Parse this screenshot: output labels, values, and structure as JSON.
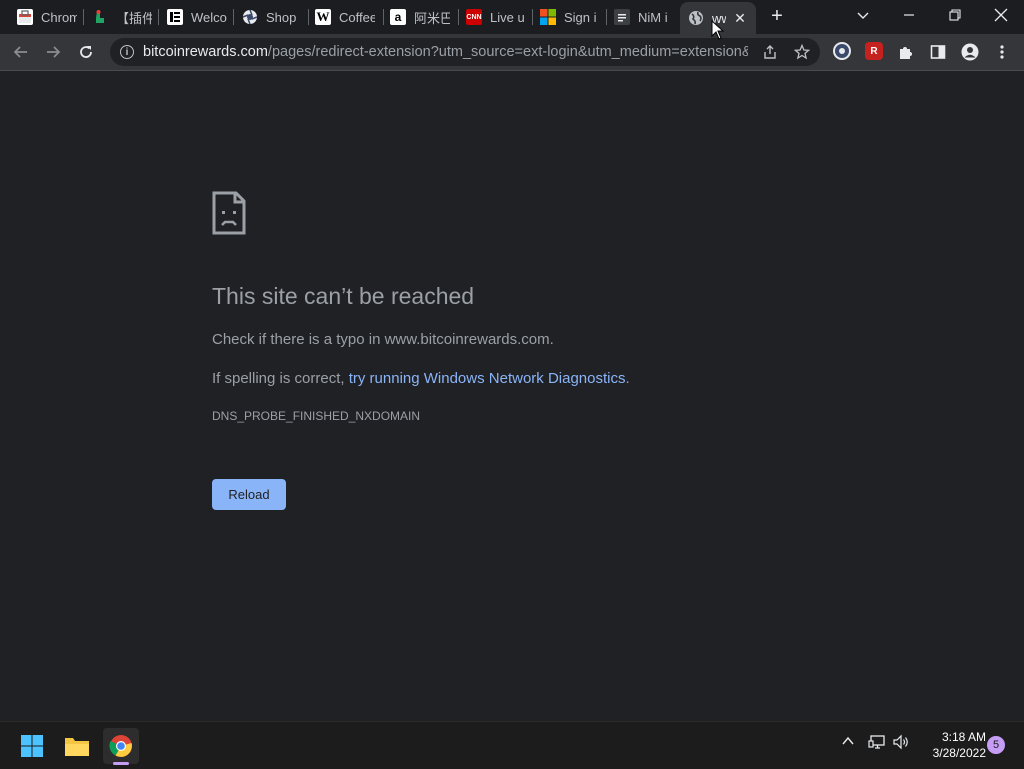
{
  "tabs": [
    {
      "label": "Chrom",
      "icon": "chrome-webstore-icon"
    },
    {
      "label": "【插件",
      "icon": "hand-icon"
    },
    {
      "label": "Welco",
      "icon": "e-icon"
    },
    {
      "label": "Shop",
      "icon": "aperture-icon"
    },
    {
      "label": "Coffee",
      "icon": "w-icon"
    },
    {
      "label": "阿米巴",
      "icon": "amazon-icon"
    },
    {
      "label": "Live u",
      "icon": "cnn-icon"
    },
    {
      "label": "Sign i",
      "icon": "microsoft-icon"
    },
    {
      "label": "NiM i",
      "icon": "doc-icon"
    }
  ],
  "active_tab": {
    "label": "ww",
    "icon": "globe-icon",
    "close": "✕"
  },
  "new_tab": "+",
  "window_controls": {
    "dropdown": "⌄",
    "minimize": "—",
    "restore": "❐",
    "close": "✕"
  },
  "address_bar": {
    "host": "bitcoinrewards.com",
    "path": "/pages/redirect-extension?utm_source=ext-login&utm_medium=extension&..."
  },
  "extensions": {
    "r_badge": "R"
  },
  "error_page": {
    "title": "This site can’t be reached",
    "line1": "Check if there is a typo in www.bitcoinrewards.com.",
    "line2_prefix": "If spelling is correct, ",
    "line2_link": "try running Windows Network Diagnostics",
    "line2_suffix": ".",
    "code": "DNS_PROBE_FINISHED_NXDOMAIN",
    "reload_label": "Reload"
  },
  "taskbar": {
    "time": "3:18 AM",
    "date": "3/28/2022",
    "notification_count": "5"
  },
  "colors": {
    "accent": "#8ab4f8",
    "background": "#202124",
    "toolbar": "#35363a"
  }
}
